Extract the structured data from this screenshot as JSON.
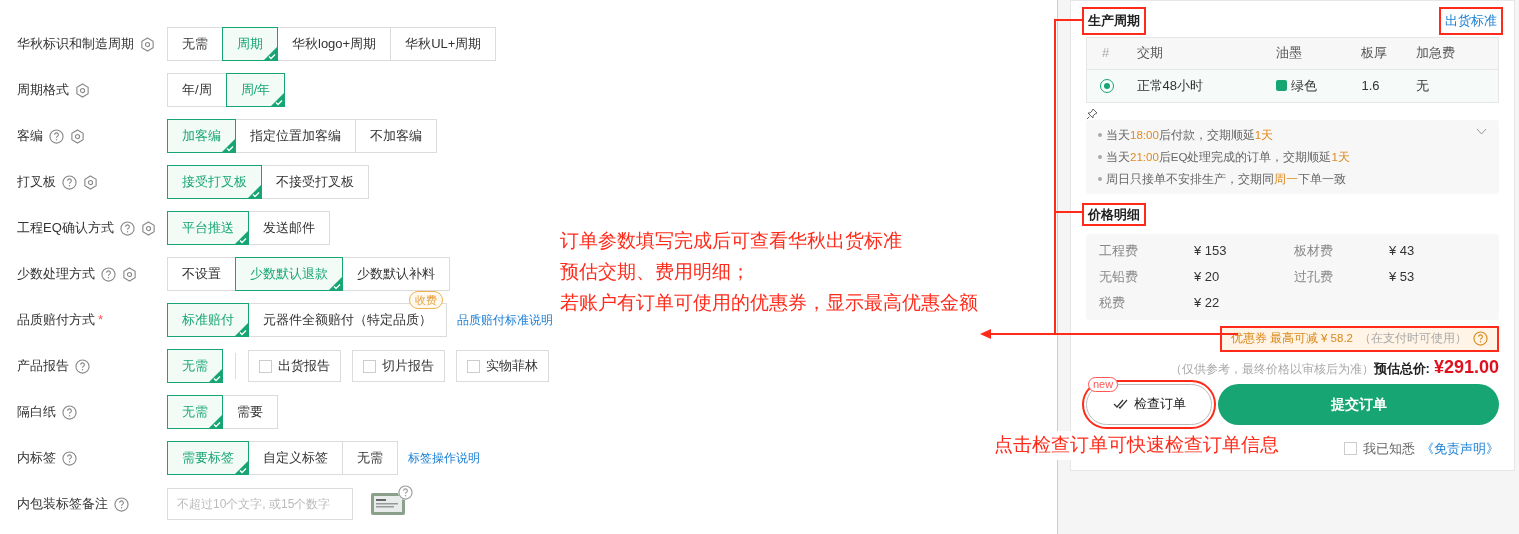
{
  "form": {
    "rows": [
      {
        "kind": "options",
        "label": "华秋标识和制造周期",
        "required": false,
        "help": false,
        "settings": true,
        "options": [
          {
            "label": "无需",
            "selected": false
          },
          {
            "label": "周期",
            "selected": true
          },
          {
            "label": "华秋logo+周期",
            "selected": false
          },
          {
            "label": "华秋UL+周期",
            "selected": false
          }
        ]
      },
      {
        "kind": "options",
        "label": "周期格式",
        "required": false,
        "help": false,
        "settings": true,
        "options": [
          {
            "label": "年/周",
            "selected": false
          },
          {
            "label": "周/年",
            "selected": true
          }
        ]
      },
      {
        "kind": "options",
        "label": "客编",
        "required": false,
        "help": true,
        "settings": true,
        "options": [
          {
            "label": "加客编",
            "selected": true
          },
          {
            "label": "指定位置加客编",
            "selected": false
          },
          {
            "label": "不加客编",
            "selected": false
          }
        ]
      },
      {
        "kind": "options",
        "label": "打叉板",
        "required": false,
        "help": true,
        "settings": true,
        "options": [
          {
            "label": "接受打叉板",
            "selected": true
          },
          {
            "label": "不接受打叉板",
            "selected": false
          }
        ]
      },
      {
        "kind": "options",
        "label": "工程EQ确认方式",
        "required": false,
        "help": true,
        "settings": true,
        "options": [
          {
            "label": "平台推送",
            "selected": true
          },
          {
            "label": "发送邮件",
            "selected": false
          }
        ]
      },
      {
        "kind": "options",
        "label": "少数处理方式",
        "required": false,
        "help": true,
        "settings": true,
        "options": [
          {
            "label": "不设置",
            "selected": false
          },
          {
            "label": "少数默认退款",
            "selected": true
          },
          {
            "label": "少数默认补料",
            "selected": false
          }
        ]
      },
      {
        "kind": "options",
        "label": "品质赔付方式",
        "required": true,
        "required_mark": "*",
        "help": false,
        "settings": false,
        "options": [
          {
            "label": "标准赔付",
            "selected": true
          },
          {
            "label": "元器件全额赔付（特定品质）",
            "selected": false,
            "badge": "收费"
          }
        ],
        "link": "品质赔付标准说明"
      },
      {
        "kind": "options",
        "label": "产品报告",
        "required": false,
        "help": true,
        "settings": false,
        "options": [
          {
            "label": "无需",
            "selected": true
          }
        ],
        "checkboxes": [
          {
            "label": "出货报告",
            "checked": false
          },
          {
            "label": "切片报告",
            "checked": false
          },
          {
            "label": "实物菲林",
            "checked": false
          }
        ]
      },
      {
        "kind": "options",
        "label": "隔白纸",
        "required": false,
        "help": true,
        "settings": false,
        "options": [
          {
            "label": "无需",
            "selected": true
          },
          {
            "label": "需要",
            "selected": false
          }
        ]
      },
      {
        "kind": "options",
        "label": "内标签",
        "required": false,
        "help": true,
        "settings": false,
        "options": [
          {
            "label": "需要标签",
            "selected": true
          },
          {
            "label": "自定义标签",
            "selected": false
          },
          {
            "label": "无需",
            "selected": false
          }
        ],
        "link": "标签操作说明"
      },
      {
        "kind": "input",
        "label": "内包装标签备注",
        "required": false,
        "help": true,
        "settings": false,
        "placeholder": "不超过10个文字, 或15个数字"
      }
    ]
  },
  "cycle": {
    "title": "生产周期",
    "title_annotated": true,
    "link": "出货标准",
    "link_annotated": true,
    "columns": [
      "#",
      "交期",
      "油墨",
      "板厚",
      "加急费"
    ],
    "rows": [
      {
        "selected": true,
        "delivery": "正常48小时",
        "ink": "绿色",
        "color": "#17a673",
        "thickness": "1.6",
        "rush_fee": "无"
      }
    ],
    "notes_expanded": false,
    "notes": [
      [
        {
          "text": "当天",
          "highlight": false
        },
        {
          "text": "18:00",
          "highlight": true
        },
        {
          "text": "后付款，交期顺延",
          "highlight": false
        },
        {
          "text": "1天",
          "highlight": true
        }
      ],
      [
        {
          "text": "当天",
          "highlight": false
        },
        {
          "text": "21:00",
          "highlight": true
        },
        {
          "text": "后EQ处理完成的订单，交期顺延",
          "highlight": false
        },
        {
          "text": "1天",
          "highlight": true
        }
      ],
      [
        {
          "text": "周日只接单不安排生产，交期同",
          "highlight": false
        },
        {
          "text": "周一",
          "highlight": true
        },
        {
          "text": "下单一致",
          "highlight": false
        }
      ]
    ]
  },
  "price": {
    "title": "价格明细",
    "title_annotated": true,
    "items": [
      {
        "label": "工程费",
        "value": "¥ 153"
      },
      {
        "label": "板材费",
        "value": "¥ 43"
      },
      {
        "label": "无铅费",
        "value": "¥ 20"
      },
      {
        "label": "过孔费",
        "value": "¥ 53"
      },
      {
        "label": "税费",
        "value": "¥ 22"
      }
    ],
    "coupon": {
      "text": "优惠券 最高可减 ¥ 58.2",
      "note": "（在支付时可使用）",
      "annotated": true
    },
    "total_note": "（仅供参考，最终价格以审核后为准）",
    "total_label": "预估总价:",
    "total": "¥291.00"
  },
  "actions": {
    "check": {
      "label": "检查订单",
      "badge": "new",
      "annotated": true
    },
    "submit": "提交订单",
    "agree": {
      "label": "我已知悉",
      "checked": false
    },
    "disclaimer": "《免责声明》"
  },
  "annotations": {
    "lines": [
      "订单参数填写完成后可查看华秋出货标准",
      "预估交期、费用明细；",
      "若账户有订单可使用的优惠券，显示最高优惠金额"
    ],
    "bottom": "点击检查订单可快速检查订单信息"
  }
}
